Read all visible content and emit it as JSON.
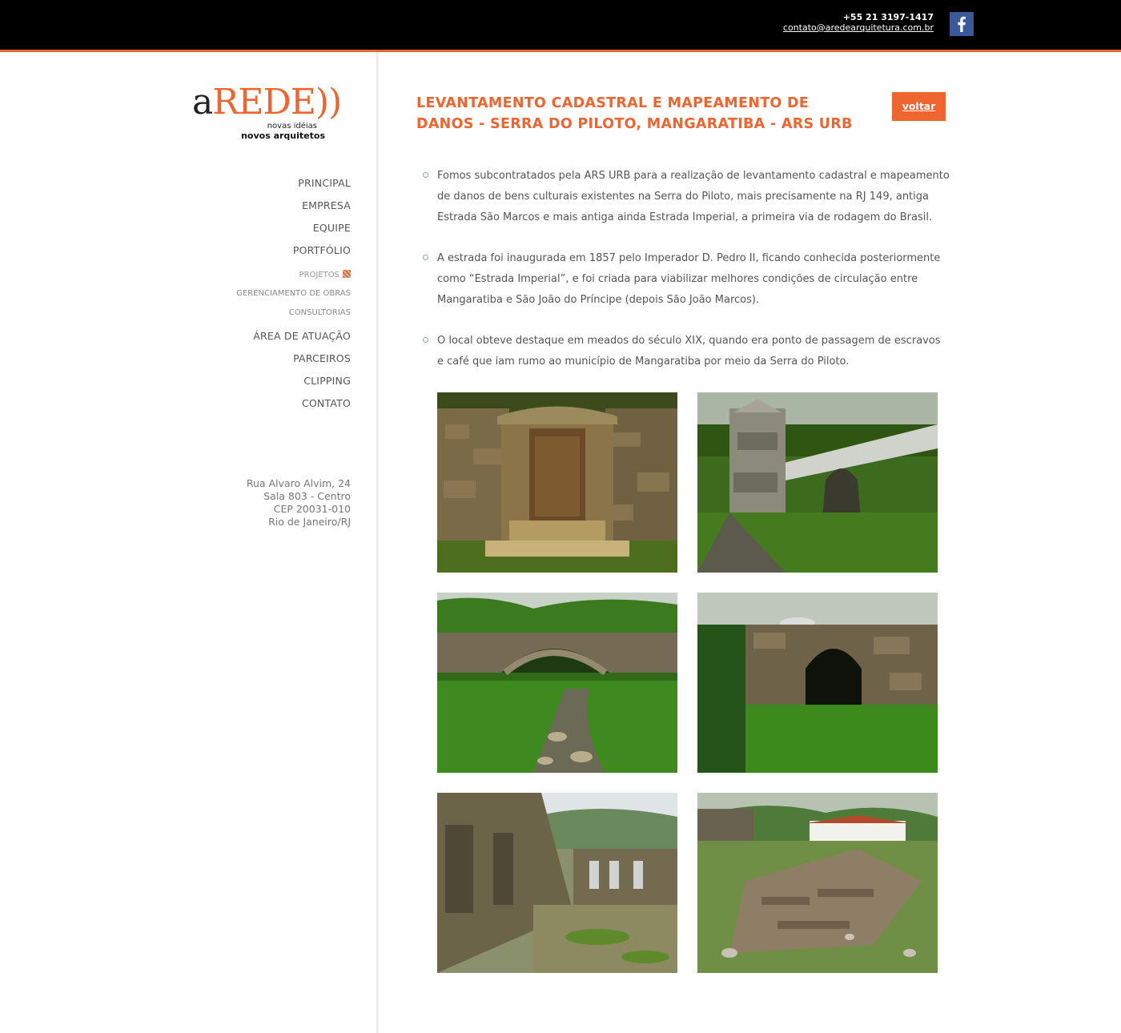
{
  "header": {
    "phone": "+55 21 3197-1417",
    "email": "contato@aredearquitetura.com.br",
    "facebook_icon": "facebook-icon"
  },
  "logo": {
    "letter": "a",
    "word": "REDE))",
    "tagline1": "novas idéias",
    "tagline2": "novos arquitetos"
  },
  "nav": {
    "items": [
      "PRINCIPAL",
      "EMPRESA",
      "EQUIPE",
      "PORTFÓLIO"
    ],
    "sub_items": [
      "PROJETOS",
      "GERENCIAMENTO DE OBRAS",
      "CONSULTORIAS"
    ],
    "items_after": [
      "ÁREA DE ATUAÇÃO",
      "PARCEIROS",
      "CLIPPING",
      "CONTATO"
    ]
  },
  "address": {
    "line1": "Rua Alvaro Alvim, 24",
    "line2": "Sala 803 - Centro",
    "line3": "CEP 20031-010",
    "line4": "Rio de Janeiro/RJ"
  },
  "main": {
    "title": "LEVANTAMENTO CADASTRAL E MAPEAMENTO DE DANOS - SERRA DO PILOTO, MANGARATIBA - ARS URB",
    "back_label": "voltar",
    "paragraphs": [
      "Fomos subcontratados pela ARS URB para a realização de levantamento cadastral e mapeamento de danos de bens culturais existentes na Serra do Piloto, mais precisamente na RJ 149, antiga Estrada São Marcos e mais antiga ainda Estrada Imperial, a primeira via de rodagem do Brasil.",
      "A estrada foi inaugurada em 1857 pelo Imperador D. Pedro II, ficando conhecida posteriormente como “Estrada Imperial”, e foi criada para viabilizar melhores condições de circulação entre Mangaratiba e São João do Príncipe (depois São João Marcos).",
      "O local obteve destaque em meados do século XIX, quando era ponto de passagem de escravos e café que iam rumo ao município de Mangaratiba por meio da Serra do Piloto."
    ]
  },
  "colors": {
    "accent": "#f0642f",
    "topbar": "#000000",
    "text": "#555555"
  }
}
